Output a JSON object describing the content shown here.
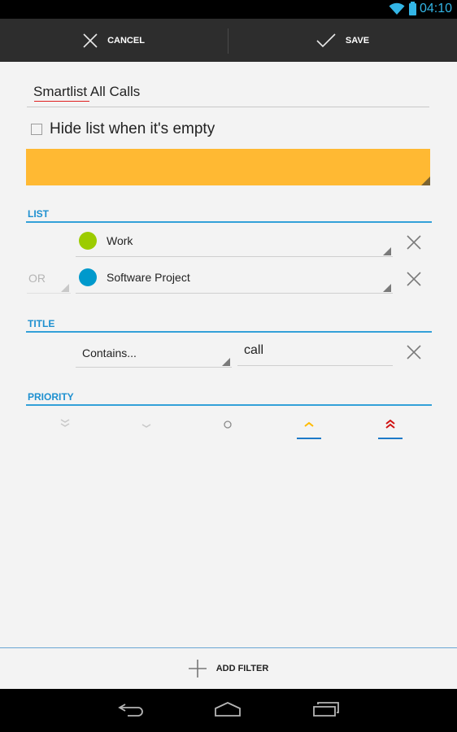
{
  "status_bar": {
    "time": "04:10",
    "icons": [
      "wifi-icon",
      "battery-icon"
    ],
    "accent_color": "#33b5e5"
  },
  "action_bar": {
    "cancel_label": "CANCEL",
    "save_label": "SAVE",
    "cancel_icon": "close-icon",
    "save_icon": "checkmark-icon"
  },
  "form": {
    "name_value": "Smartlist All Calls",
    "hide_when_empty": {
      "label": "Hide list when it's empty",
      "checked": false
    },
    "color": "#ffb933"
  },
  "sections": {
    "list": {
      "header": "LIST",
      "rows": [
        {
          "connector": "",
          "value": "Work",
          "color": "#9ccc00"
        },
        {
          "connector": "OR",
          "value": "Software Project",
          "color": "#0099cc"
        }
      ]
    },
    "title": {
      "header": "TITLE",
      "operator": "Contains...",
      "value": "call"
    },
    "priority": {
      "header": "PRIORITY",
      "levels": [
        {
          "name": "lowest",
          "icon": "double-chevron-down-icon",
          "selected": false,
          "color": "#c8c8c8"
        },
        {
          "name": "low",
          "icon": "chevron-down-icon",
          "selected": false,
          "color": "#c8c8c8"
        },
        {
          "name": "normal",
          "icon": "circle-icon",
          "selected": false,
          "color": "#8a8a8a"
        },
        {
          "name": "high",
          "icon": "chevron-up-icon",
          "selected": true,
          "color": "#ffbb00"
        },
        {
          "name": "highest",
          "icon": "double-chevron-up-icon",
          "selected": true,
          "color": "#d01010"
        }
      ]
    }
  },
  "footer": {
    "add_filter_label": "ADD FILTER",
    "add_icon": "plus-icon"
  },
  "nav_bar": {
    "buttons": [
      "back-icon",
      "home-icon",
      "recent-apps-icon"
    ]
  }
}
